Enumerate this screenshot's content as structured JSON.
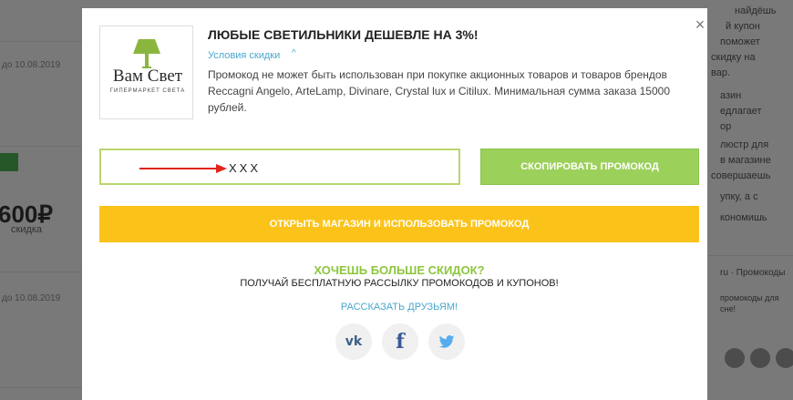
{
  "background": {
    "right_text": [
      "найдёшь",
      "й купон",
      "поможет",
      "скидку на",
      "вар.",
      "азин",
      "едлагает",
      "ор",
      "люстр для",
      "в магазине",
      "совершаешь",
      "упку, а с",
      "кономишь"
    ],
    "date1": "до 10.08.2019",
    "date2": "до 10.08.2019",
    "discount_value": "600₽",
    "discount_label": "скидка",
    "right_promo": "ru · Промокоды",
    "right_promo2": "промокоды для",
    "right_promo3": "сне!"
  },
  "modal": {
    "close_label": "×",
    "logo": {
      "name": "Вам Свет",
      "subtitle": "ГИПЕРМАРКЕТ СВЕТА"
    },
    "title": "ЛЮБЫЕ СВЕТИЛЬНИКИ ДЕШЕВЛЕ НА 3%!",
    "terms_label": "Условия скидки",
    "terms_chevron": "^",
    "description": "Промокод не может быть использован при покупке акционных товаров и товаров брендов Reccagni Angelo, ArteLamp, Divinare, Crystal lux и Citilux. Минимальная сумма заказа 15000 рублей.",
    "code_value": "XXX",
    "copy_button": "СКОПИРОВАТЬ ПРОМОКОД",
    "open_button": "ОТКРЫТЬ МАГАЗИН И ИСПОЛЬЗОВАТЬ ПРОМОКОД",
    "promo_heading": "ХОЧЕШЬ БОЛЬШЕ СКИДОК?",
    "promo_sub": "ПОЛУЧАЙ БЕСПЛАТНУЮ РАССЫЛКУ ПРОМОКОДОВ И КУПОНОВ!",
    "share_link": "РАССКАЗАТЬ ДРУЗЬЯМ!",
    "social": {
      "vk": "vk",
      "fb": "f"
    }
  },
  "colors": {
    "green": "#9bd05a",
    "yellow": "#fbc31a",
    "link": "#4aa6cd",
    "promo_green": "#8cc63e"
  },
  "icons": [
    "close-icon",
    "chevron-up-icon",
    "arrow-icon",
    "vk-icon",
    "facebook-icon",
    "twitter-icon",
    "lamp-logo-icon"
  ]
}
